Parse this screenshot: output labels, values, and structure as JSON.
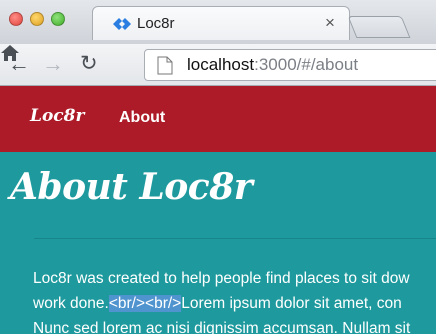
{
  "browser": {
    "tab_title": "Loc8r",
    "tab_close": "×",
    "url_host": "localhost",
    "url_rest": ":3000/#/about"
  },
  "navbar": {
    "brand": "Loc8r",
    "links": [
      "About"
    ]
  },
  "page": {
    "title": "About Loc8r",
    "line1": "Loc8r was created to help people find places to sit dow",
    "line2_before": "work done.",
    "line2_selected": "<br/><br/>",
    "line2_after": "Lorem ipsum dolor sit amet, con",
    "line3": "Nunc sed lorem ac nisi dignissim accumsan. Nullam sit"
  },
  "colors": {
    "navbar": "#ac1b27",
    "content": "#1e9a9e",
    "selection": "#4f93cf"
  }
}
